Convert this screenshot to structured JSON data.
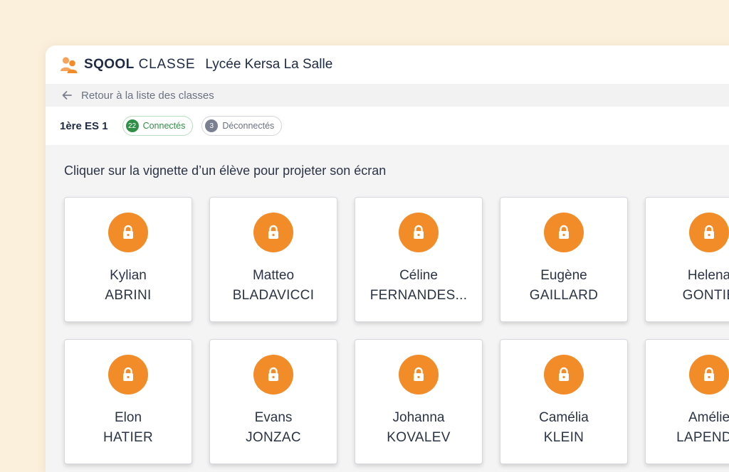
{
  "header": {
    "brand_bold": "SQOOL",
    "brand_light": "CLASSE",
    "school": "Lycée Kersa La Salle"
  },
  "nav": {
    "back_label": "Retour à la liste des classes"
  },
  "classbar": {
    "class_name": "1ère ES 1",
    "connected": {
      "count": "22",
      "label": "Connectés"
    },
    "disconnected": {
      "count": "3",
      "label": "Déconnectés"
    }
  },
  "main": {
    "instruction": "Cliquer sur la vignette d’un élève pour projeter son écran",
    "students": [
      {
        "first": "Kylian",
        "last": "ABRINI"
      },
      {
        "first": "Matteo",
        "last": "BLADAVICCI"
      },
      {
        "first": "Céline",
        "last": "FERNANDES..."
      },
      {
        "first": "Eugène",
        "last": "GAILLARD"
      },
      {
        "first": "Helena",
        "last": "GONTIE"
      },
      {
        "first": "Elon",
        "last": "HATIER"
      },
      {
        "first": "Evans",
        "last": "JONZAC"
      },
      {
        "first": "Johanna",
        "last": "KOVALEV"
      },
      {
        "first": "Camélia",
        "last": "KLEIN"
      },
      {
        "first": "Amélie",
        "last": "LAPENDU"
      }
    ]
  },
  "colors": {
    "accent": "#f28c28",
    "connected": "#2f8f46",
    "disconnected": "#7b8090",
    "text": "#1f2a44"
  }
}
